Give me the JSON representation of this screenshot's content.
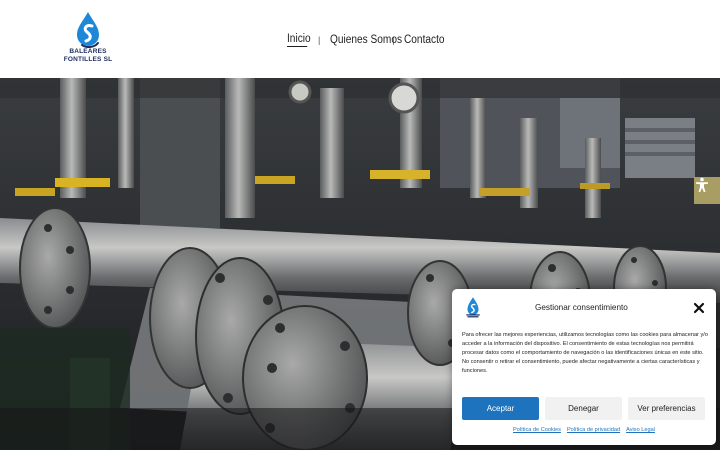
{
  "brand": {
    "line1": "BALEARES",
    "line2": "FONTILLES SL",
    "logo_icon": "water-drop-s-logo",
    "colors": {
      "navy": "#1d2d62",
      "blue": "#1e88d8"
    }
  },
  "nav": {
    "items": [
      {
        "label": "Inicio",
        "active": true
      },
      {
        "label": "Quienes Somos",
        "active": false
      },
      {
        "label": "Contacto",
        "active": false
      }
    ],
    "separator": "|"
  },
  "hero": {
    "image": "industrial-pipes-valves-photo"
  },
  "accessibility": {
    "icon": "accessibility-person-icon",
    "color": "#a89d62"
  },
  "cookie": {
    "title": "Gestionar consentimiento",
    "body": "Para ofrecer las mejores experiencias, utilizamos tecnologías como las cookies para almacenar y/o acceder a la información del dispositivo. El consentimiento de estas tecnologías nos permitirá procesar datos como el comportamiento de navegación o las identificaciones únicas en este sitio. No consentir o retirar el consentimiento, puede afectar negativamente a ciertas características y funciones.",
    "accept_label": "Aceptar",
    "deny_label": "Denegar",
    "prefs_label": "Ver preferencias",
    "links": {
      "cookies": "Política de Cookies",
      "privacy": "Política de privacidad",
      "legal": "Aviso Legal"
    },
    "accent": "#1e73be"
  }
}
